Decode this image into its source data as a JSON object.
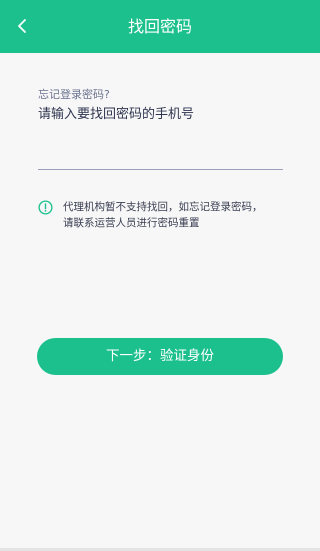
{
  "header": {
    "title": "找回密码",
    "back_icon": "chevron-left-icon",
    "background_color": "#1cc08c"
  },
  "form": {
    "hint": "忘记登录密码?",
    "phone_label": "请输入要找回密码的手机号",
    "phone_value": "",
    "phone_placeholder": ""
  },
  "notice": {
    "icon": "info-circle-icon",
    "icon_color": "#1cc08c",
    "line1": "代理机构暂不支持找回，如忘记登录密码，",
    "line2": "请联系运营人员进行密码重置"
  },
  "actions": {
    "next_label": "下一步：验证身份"
  }
}
